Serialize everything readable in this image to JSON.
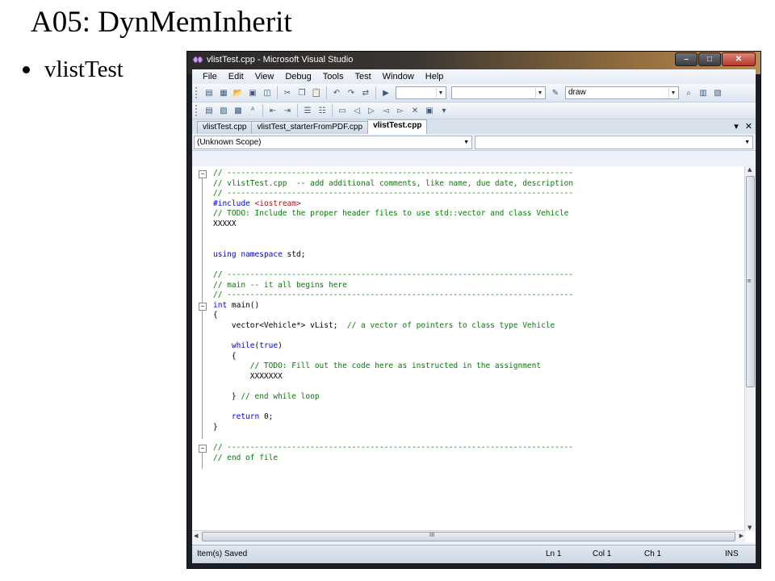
{
  "slide": {
    "title": "A05: DynMemInherit",
    "bullet": "vlistTest"
  },
  "window": {
    "title": "vlistTest.cpp - Microsoft Visual Studio",
    "controls": {
      "minimize": "–",
      "maximize": "□",
      "close": "✕"
    }
  },
  "menu": [
    "File",
    "Edit",
    "View",
    "Debug",
    "Tools",
    "Test",
    "Window",
    "Help"
  ],
  "toolbar": {
    "find_combo_value": "draw"
  },
  "tabs": [
    {
      "label": "vlistTest.cpp",
      "active": false
    },
    {
      "label": "vlistTest_starterFromPDF.cpp",
      "active": false
    },
    {
      "label": "vlistTest.cpp",
      "active": true
    }
  ],
  "tab_controls": {
    "dropdown": "▾",
    "close": "✕"
  },
  "scope": {
    "left": "(Unknown Scope)",
    "right": ""
  },
  "code_lines": [
    "// ---------------------------------------------------------------------------",
    "// vlistTest.cpp  -- add additional comments, like name, due date, description",
    "// ---------------------------------------------------------------------------",
    "#include <iostream>",
    "// TODO: Include the proper header files to use std::vector and class Vehicle",
    "XXXXX",
    "",
    "",
    "using namespace std;",
    "",
    "// ---------------------------------------------------------------------------",
    "// main -- it all begins here",
    "// ---------------------------------------------------------------------------",
    "int main()",
    "{",
    "    vector<Vehicle*> vList;  // a vector of pointers to class type Vehicle",
    "",
    "    while(true)",
    "    {",
    "        // TODO: Fill out the code here as instructed in the assignment",
    "        XXXXXXX",
    "",
    "    } // end while loop",
    "",
    "    return 0;",
    "}",
    "",
    "// ---------------------------------------------------------------------------",
    "// end of file"
  ],
  "scroll": {
    "h_mid": "III",
    "v_mid": "≡"
  },
  "status": {
    "message": "Item(s) Saved",
    "ln": "Ln 1",
    "col": "Col 1",
    "ch": "Ch 1",
    "mode": "INS"
  }
}
